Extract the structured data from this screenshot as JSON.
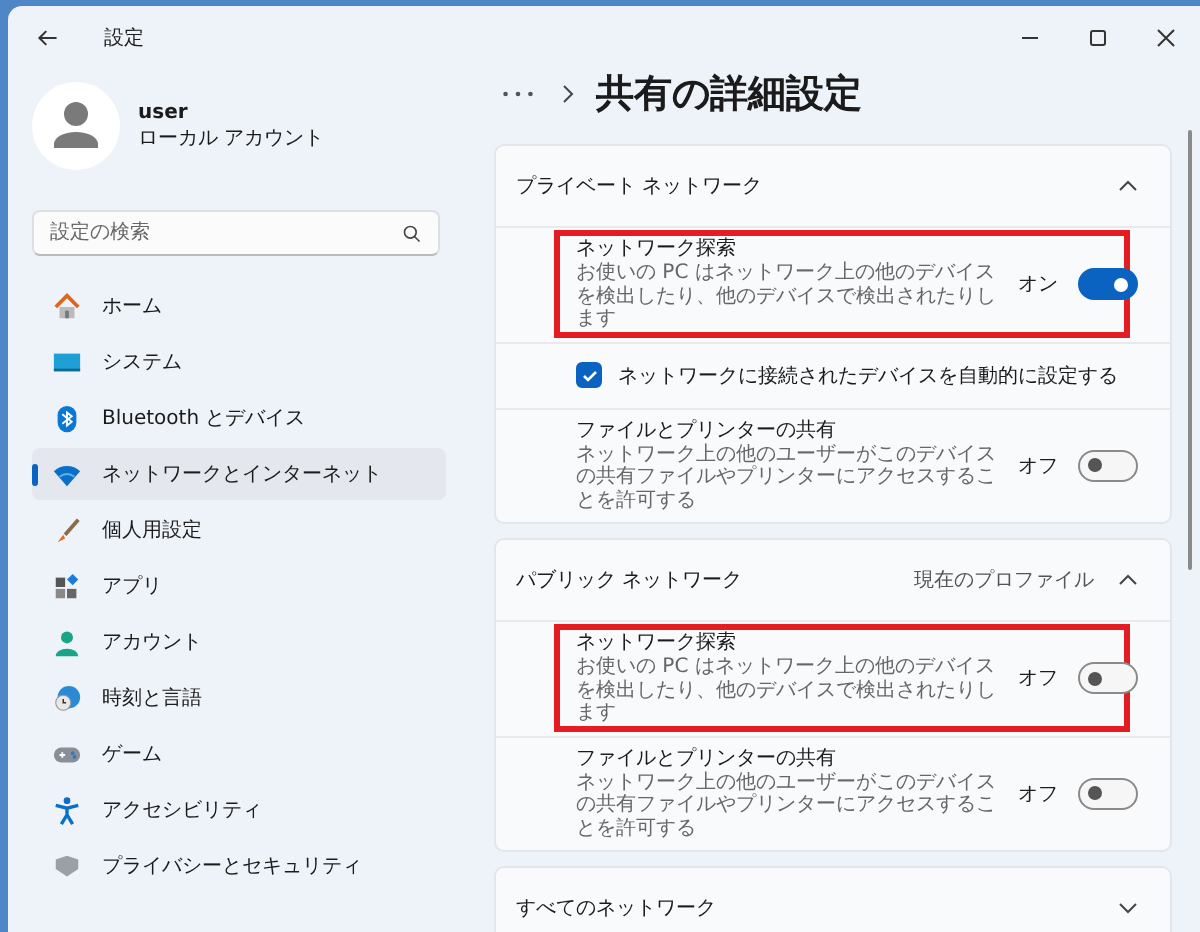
{
  "window": {
    "title": "設定"
  },
  "user": {
    "name": "user",
    "account": "ローカル アカウント"
  },
  "search": {
    "placeholder": "設定の検索"
  },
  "nav": [
    {
      "label": "ホーム",
      "selected": false
    },
    {
      "label": "システム",
      "selected": false
    },
    {
      "label": "Bluetooth とデバイス",
      "selected": false
    },
    {
      "label": "ネットワークとインターネット",
      "selected": true
    },
    {
      "label": "個人用設定",
      "selected": false
    },
    {
      "label": "アプリ",
      "selected": false
    },
    {
      "label": "アカウント",
      "selected": false
    },
    {
      "label": "時刻と言語",
      "selected": false
    },
    {
      "label": "ゲーム",
      "selected": false
    },
    {
      "label": "アクセシビリティ",
      "selected": false
    },
    {
      "label": "プライバシーとセキュリティ",
      "selected": false
    }
  ],
  "page_title": "共有の詳細設定",
  "sections": [
    {
      "title": "プライベート ネットワーク",
      "expanded": true,
      "rows": [
        {
          "kind": "toggle",
          "title": "ネットワーク探索",
          "description": "お使いの PC はネットワーク上の他のデバイスを検出したり、他のデバイスで検出されたりします",
          "state_label": "オン",
          "on": true,
          "highlighted": true
        },
        {
          "kind": "checkbox",
          "label": "ネットワークに接続されたデバイスを自動的に設定する",
          "checked": true
        },
        {
          "kind": "toggle",
          "title": "ファイルとプリンターの共有",
          "description": "ネットワーク上の他のユーザーがこのデバイスの共有ファイルやプリンターにアクセスすることを許可する",
          "state_label": "オフ",
          "on": false
        }
      ]
    },
    {
      "title": "パブリック ネットワーク",
      "profile_label": "現在のプロファイル",
      "expanded": true,
      "rows": [
        {
          "kind": "toggle",
          "title": "ネットワーク探索",
          "description": "お使いの PC はネットワーク上の他のデバイスを検出したり、他のデバイスで検出されたりします",
          "state_label": "オフ",
          "on": false,
          "highlighted": true
        },
        {
          "kind": "toggle",
          "title": "ファイルとプリンターの共有",
          "description": "ネットワーク上の他のユーザーがこのデバイスの共有ファイルやプリンターにアクセスすることを許可する",
          "state_label": "オフ",
          "on": false
        }
      ]
    },
    {
      "title": "すべてのネットワーク",
      "expanded": false
    }
  ]
}
